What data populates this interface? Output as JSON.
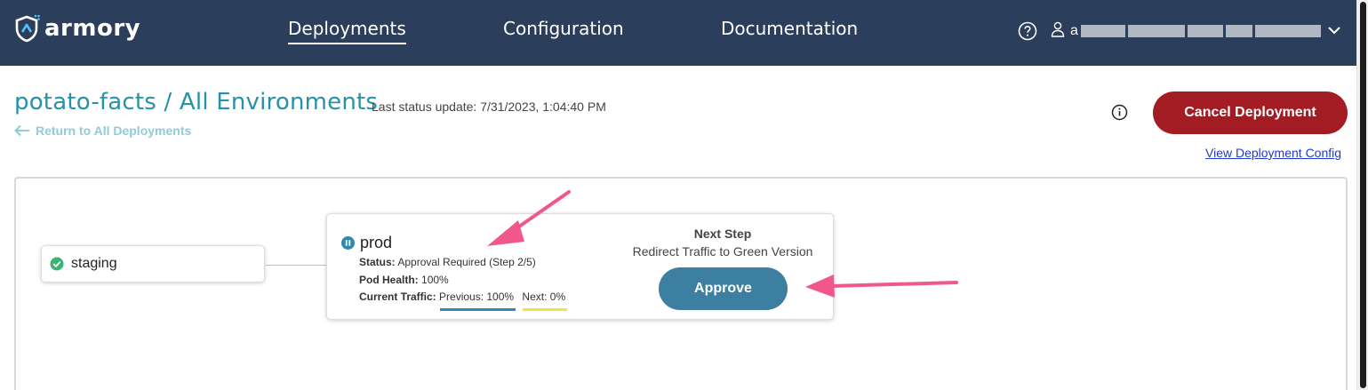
{
  "header": {
    "logo_text": "armory",
    "nav": [
      {
        "label": "Deployments",
        "active": true
      },
      {
        "label": "Configuration",
        "active": false
      },
      {
        "label": "Documentation",
        "active": false
      }
    ],
    "user_initial": "a",
    "brand_color": "#2b3e5c"
  },
  "page": {
    "title": "potato-facts / All Environments",
    "status_update": "Last status update: 7/31/2023, 1:04:40 PM",
    "return_link": "Return to All Deployments",
    "cancel_button": "Cancel Deployment",
    "view_config_link": "View Deployment Config"
  },
  "environments": {
    "staging": {
      "name": "staging",
      "status_icon": "check-circle-icon",
      "status_color": "#3cb371"
    },
    "prod": {
      "name": "prod",
      "status_icon": "pause-circle-icon",
      "status_label": "Status:",
      "status_value": "Approval Required (Step 2/5)",
      "health_label": "Pod Health:",
      "health_value": "100%",
      "traffic_label": "Current Traffic:",
      "traffic_previous": "Previous: 100%",
      "traffic_next": "Next: 0%",
      "next_step_title": "Next Step",
      "next_step_desc": "Redirect Traffic to Green Version",
      "approve_button": "Approve"
    }
  },
  "colors": {
    "cancel": "#a31c23",
    "approve": "#3d7fa0",
    "title": "#2592a8",
    "annotation_arrow": "#f0588a"
  }
}
